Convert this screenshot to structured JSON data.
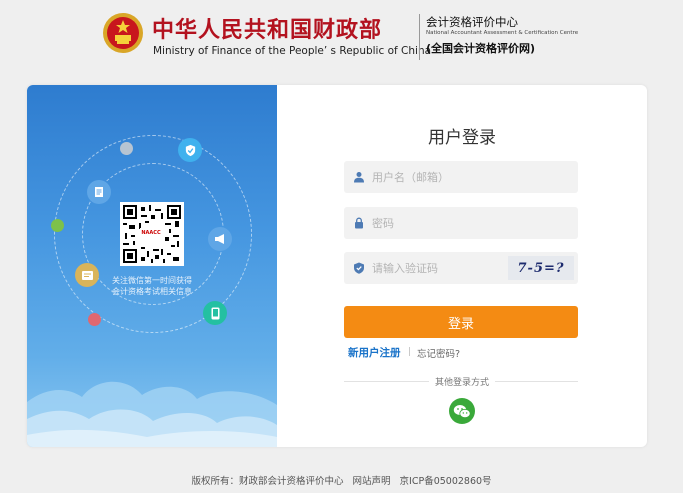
{
  "header": {
    "title_cn": "中华人民共和国财政部",
    "title_en": "Ministry of Finance of the People’ s Republic of China",
    "center_cn": "会计资格评价中心",
    "center_en": "National Accountant Assessment & Certification Centre",
    "center_sub": "(全国会计资格评价网)"
  },
  "promo": {
    "qr_badge": "NAACC",
    "qr_text_line1": "关注微信第一时间获得",
    "qr_text_line2": "会计资格考试相关信息"
  },
  "login": {
    "title": "用户登录",
    "username_placeholder": "用户名（邮箱）",
    "password_placeholder": "密码",
    "captcha_placeholder": "请输入验证码",
    "captcha_text": "7-5=?",
    "login_button": "登录",
    "register_link": "新用户注册",
    "separator": "|",
    "forgot_link": "忘记密码?",
    "other_methods": "其他登录方式"
  },
  "footer": {
    "copyright": "版权所有：财政部会计资格评价中心",
    "statement": "网站声明",
    "icp": "京ICP备05002860号"
  },
  "colors": {
    "brand_red": "#b3121f",
    "panel_blue": "#2e7ccf",
    "login_orange": "#f48b13",
    "link_blue": "#1a73c9",
    "wechat_green": "#3aa93a"
  },
  "icons": [
    "national-emblem-icon",
    "shield-check-icon",
    "document-icon",
    "megaphone-icon",
    "book-icon",
    "phone-icon",
    "user-icon",
    "lock-icon",
    "shield-icon",
    "wechat-icon"
  ]
}
